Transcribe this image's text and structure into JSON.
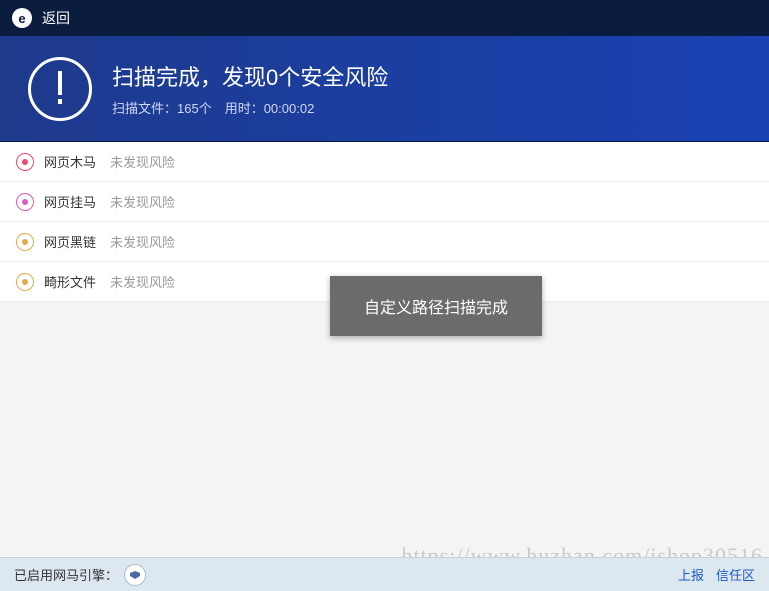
{
  "topbar": {
    "logo_letter": "e",
    "back_label": "返回"
  },
  "header": {
    "title": "扫描完成，发现0个安全风险",
    "subtitle": "扫描文件：165个　用时：00:00:02"
  },
  "categories": [
    {
      "icon_color": "#e84c6a",
      "label": "网页木马",
      "status": "未发现风险"
    },
    {
      "icon_color": "#d659c4",
      "label": "网页挂马",
      "status": "未发现风险"
    },
    {
      "icon_color": "#e8a74c",
      "label": "网页黑链",
      "status": "未发现风险"
    },
    {
      "icon_color": "#e8a74c",
      "label": "畸形文件",
      "status": "未发现风险"
    }
  ],
  "toast": {
    "message": "自定义路径扫描完成"
  },
  "footer": {
    "engine_label": "已启用网马引擎：",
    "links": {
      "report": "上报",
      "trust": "信任区"
    }
  },
  "watermark": "https://www.huzhan.com/ishop30516"
}
